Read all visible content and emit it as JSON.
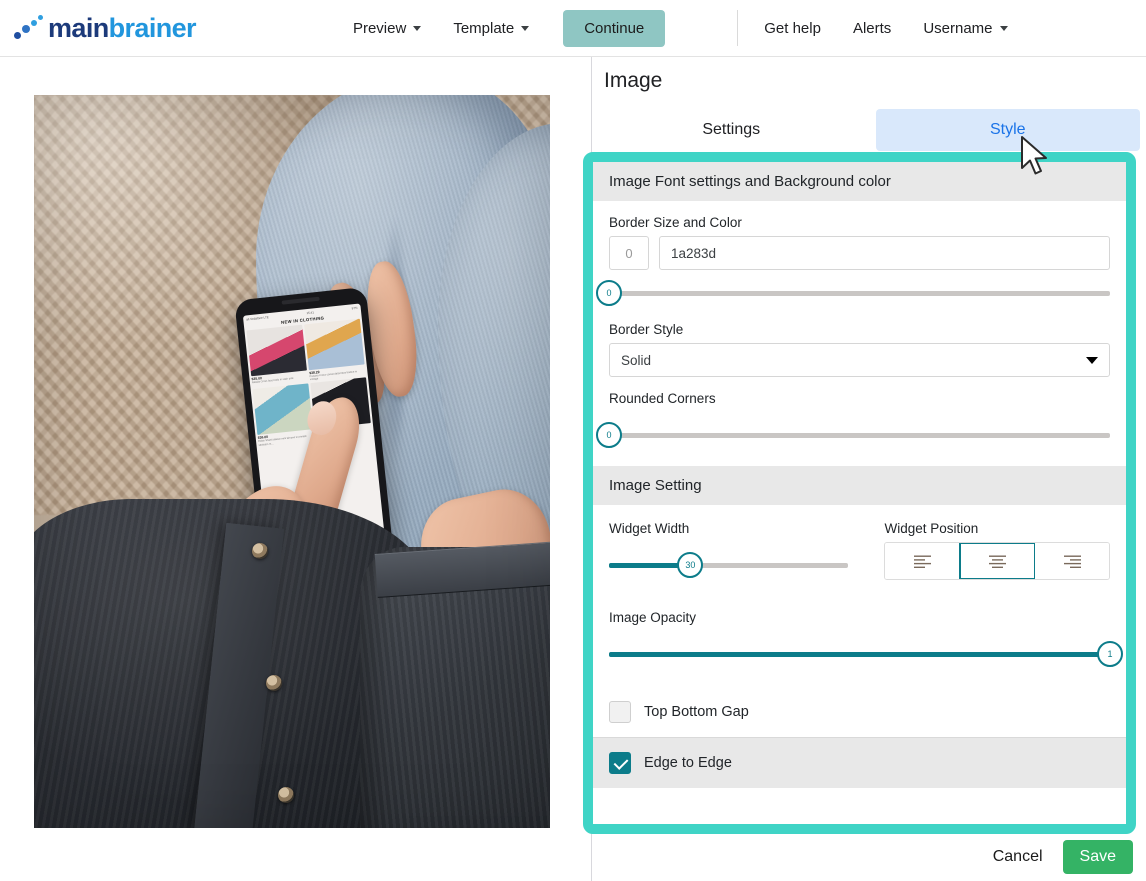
{
  "header": {
    "logo": {
      "part1": "main",
      "part2": "brainer",
      "dots_icon": "logo-dots-icon"
    },
    "nav": [
      {
        "label": "Preview",
        "has_caret": true
      },
      {
        "label": "Template",
        "has_caret": true
      }
    ],
    "continue_label": "Continue",
    "right_nav": [
      {
        "label": "Get help",
        "has_caret": false
      },
      {
        "label": "Alerts",
        "has_caret": false
      },
      {
        "label": "Username",
        "has_caret": true
      }
    ]
  },
  "panel": {
    "title": "Image",
    "tabs": [
      {
        "label": "Settings",
        "active": false
      },
      {
        "label": "Style",
        "active": true
      }
    ],
    "section_font": {
      "heading": "Image Font settings and Background color",
      "border_size_color_label": "Border Size and Color",
      "border_size_value": "0",
      "border_color_value": "1a283d",
      "border_size_slider": {
        "value": "0",
        "percent": 0
      },
      "border_style_label": "Border Style",
      "border_style_value": "Solid",
      "rounded_corners_label": "Rounded Corners",
      "rounded_corners_slider": {
        "value": "0",
        "percent": 0
      }
    },
    "section_image": {
      "heading": "Image Setting",
      "widget_width_label": "Widget Width",
      "widget_width_slider": {
        "value": "30",
        "percent": 34
      },
      "widget_position_label": "Widget Position",
      "widget_position_options": [
        {
          "name": "align-left-icon",
          "selected": false
        },
        {
          "name": "align-center-icon",
          "selected": true
        },
        {
          "name": "align-right-icon",
          "selected": false
        }
      ],
      "image_opacity_label": "Image Opacity",
      "image_opacity_slider": {
        "value": "1",
        "percent": 100
      },
      "top_bottom_gap_label": "Top Bottom Gap",
      "top_bottom_gap_checked": false,
      "edge_to_edge_label": "Edge to Edge",
      "edge_to_edge_checked": true
    },
    "footer": {
      "cancel_label": "Cancel",
      "save_label": "Save"
    }
  },
  "canvas": {
    "phone_screen": {
      "status_left": "ail Vodafone  LTE",
      "status_time": "15:41",
      "status_right": "97%",
      "title": "NEW IN CLOTHING",
      "products": [
        {
          "price": "$35.00",
          "desc": "Natalia Cross lace body in satin pink"
        },
        {
          "price": "$38.29",
          "desc": "Panana Cross corset detail lace bodice in vintage"
        },
        {
          "price": "$36.00",
          "desc": "Dolce Shawl sleeve mini kimono in printed seafoam m..."
        },
        {
          "price": "",
          "desc": ""
        }
      ]
    }
  },
  "colors": {
    "accent_teal": "#0c7c8a",
    "highlight_teal": "#3fd4c6",
    "save_green": "#34b365",
    "continue_sage": "#8fc6c3",
    "tab_active_bg": "#d9e8fb",
    "tab_active_text": "#1a73e8",
    "logo_dark": "#1c3a7a",
    "logo_light": "#2196dd"
  }
}
